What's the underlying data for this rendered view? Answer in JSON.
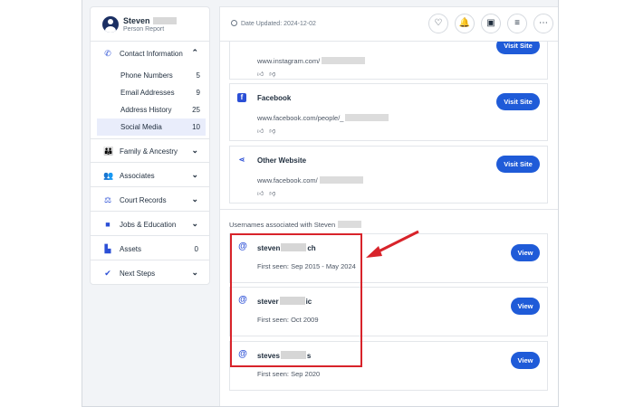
{
  "profile": {
    "name": "Steven",
    "subtitle": "Person Report"
  },
  "nav": {
    "contact": {
      "label": "Contact Information"
    },
    "sub_items": [
      {
        "label": "Phone Numbers",
        "count": "5"
      },
      {
        "label": "Email Addresses",
        "count": "9"
      },
      {
        "label": "Address History",
        "count": "25"
      },
      {
        "label": "Social Media",
        "count": "10"
      }
    ],
    "family": {
      "label": "Family & Ancestry"
    },
    "associates": {
      "label": "Associates"
    },
    "court": {
      "label": "Court Records"
    },
    "jobs": {
      "label": "Jobs & Education"
    },
    "assets": {
      "label": "Assets",
      "count": "0"
    },
    "next": {
      "label": "Next Steps"
    }
  },
  "topbar": {
    "date_updated": "Date Updated: 2024-12-02"
  },
  "social": [
    {
      "title": "",
      "url": "www.instagram.com/",
      "button": "Visit Site"
    },
    {
      "title": "Facebook",
      "url": "www.facebook.com/people/_",
      "button": "Visit Site"
    },
    {
      "title": "Other Website",
      "url": "www.facebook.com/",
      "button": "Visit Site"
    }
  ],
  "usernames": {
    "heading": "Usernames associated with Steven",
    "items": [
      {
        "prefix": "steven",
        "suffix": "ch",
        "seen": "First seen: Sep 2015 - May 2024",
        "button": "View"
      },
      {
        "prefix": "stever",
        "suffix": "ic",
        "seen": "First seen: Oct 2009",
        "button": "View"
      },
      {
        "prefix": "steves",
        "suffix": "s",
        "seen": "First seen: Sep 2020",
        "button": "View"
      }
    ]
  },
  "colors": {
    "accent": "#1f5bd8",
    "highlight": "#d8232a"
  }
}
